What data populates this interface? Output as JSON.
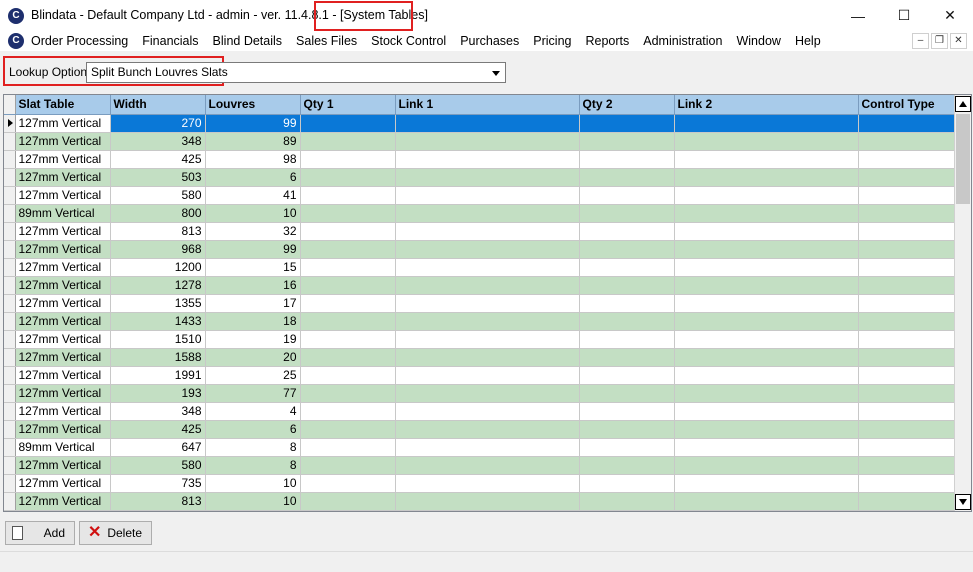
{
  "window": {
    "app_icon_glyph": "C",
    "title_main": "Blindata - Default Company Ltd - admin - ver. 11.4.8.1",
    "title_dash": " - ",
    "title_form": "[System Tables]",
    "minimize_glyph": "—",
    "maximize_glyph": "☐",
    "close_glyph": "✕"
  },
  "menu": {
    "items": [
      "Order Processing",
      "Financials",
      "Blind Details",
      "Sales Files",
      "Stock Control",
      "Purchases",
      "Pricing",
      "Reports",
      "Administration",
      "Window",
      "Help"
    ],
    "mdi_minimize_glyph": "–",
    "mdi_restore_glyph": "❐",
    "mdi_close_glyph": "✕"
  },
  "lookup": {
    "label": "Lookup Option:",
    "selected": "Split Bunch Louvres Slats"
  },
  "grid": {
    "columns": [
      "Slat Table",
      "Width",
      "Louvres",
      "Qty 1",
      "Link 1",
      "Qty 2",
      "Link 2",
      "Control Type"
    ],
    "rows": [
      [
        "127mm Vertical",
        "270",
        "99"
      ],
      [
        "127mm Vertical",
        "348",
        "89"
      ],
      [
        "127mm Vertical",
        "425",
        "98"
      ],
      [
        "127mm Vertical",
        "503",
        "6"
      ],
      [
        "127mm Vertical",
        "580",
        "41"
      ],
      [
        "89mm Vertical",
        "800",
        "10"
      ],
      [
        "127mm Vertical",
        "813",
        "32"
      ],
      [
        "127mm Vertical",
        "968",
        "99"
      ],
      [
        "127mm Vertical",
        "1200",
        "15"
      ],
      [
        "127mm Vertical",
        "1278",
        "16"
      ],
      [
        "127mm Vertical",
        "1355",
        "17"
      ],
      [
        "127mm Vertical",
        "1433",
        "18"
      ],
      [
        "127mm Vertical",
        "1510",
        "19"
      ],
      [
        "127mm Vertical",
        "1588",
        "20"
      ],
      [
        "127mm Vertical",
        "1991",
        "25"
      ],
      [
        "127mm Vertical",
        "193",
        "77"
      ],
      [
        "127mm Vertical",
        "348",
        "4"
      ],
      [
        "127mm Vertical",
        "425",
        "6"
      ],
      [
        "89mm Vertical",
        "647",
        "8"
      ],
      [
        "127mm Vertical",
        "580",
        "8"
      ],
      [
        "127mm Vertical",
        "735",
        "10"
      ],
      [
        "127mm Vertical",
        "813",
        "10"
      ]
    ],
    "selected_row": 0,
    "selection_color": "#0a78d7",
    "alt_row_color": "#c3dfc3",
    "header_color": "#a8cbea"
  },
  "buttons": {
    "add": "Add",
    "delete": "Delete"
  }
}
